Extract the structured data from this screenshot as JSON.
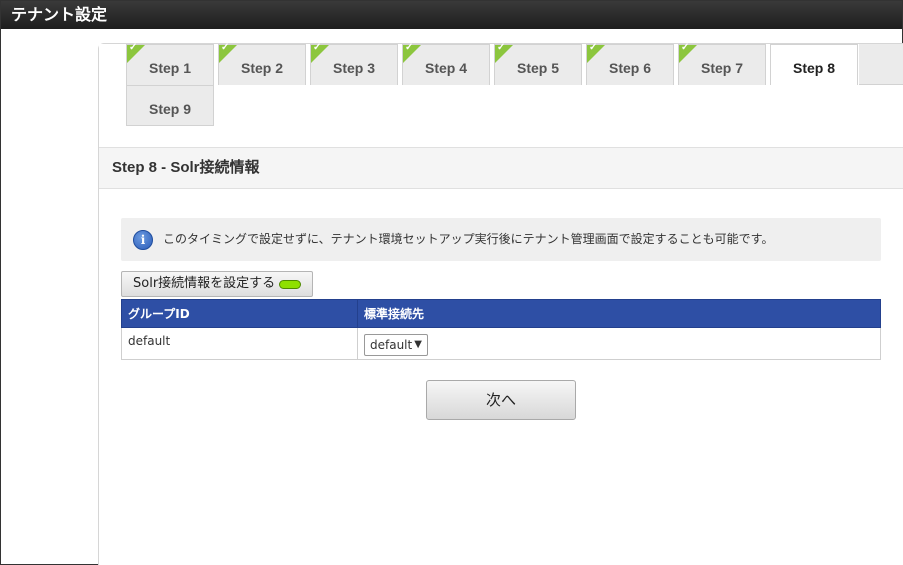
{
  "window": {
    "title": "テナント設定"
  },
  "tabs": [
    {
      "label": "Step 1",
      "done": true
    },
    {
      "label": "Step 2",
      "done": true
    },
    {
      "label": "Step 3",
      "done": true
    },
    {
      "label": "Step 4",
      "done": true
    },
    {
      "label": "Step 5",
      "done": true
    },
    {
      "label": "Step 6",
      "done": true
    },
    {
      "label": "Step 7",
      "done": true
    },
    {
      "label": "Step 8",
      "done": false,
      "active": true
    },
    {
      "label": "Step 9",
      "done": false
    }
  ],
  "section": {
    "title": "Step 8 - Solr接続情報"
  },
  "info": {
    "icon": "info-icon",
    "glyph": "i",
    "text": "このタイミングで設定せずに、テナント環境セットアップ実行後にテナント管理画面で設定することも可能です。"
  },
  "solr_button": {
    "label": "Solr接続情報を設定する",
    "led_color": "#8fe000"
  },
  "table": {
    "headers": [
      "グループID",
      "標準接続先"
    ],
    "rows": [
      {
        "group_id": "default",
        "connection": "default"
      }
    ]
  },
  "next_button": {
    "label": "次へ"
  },
  "colors": {
    "header_bg": "#2e4fa5",
    "check_green": "#8cc63e"
  }
}
